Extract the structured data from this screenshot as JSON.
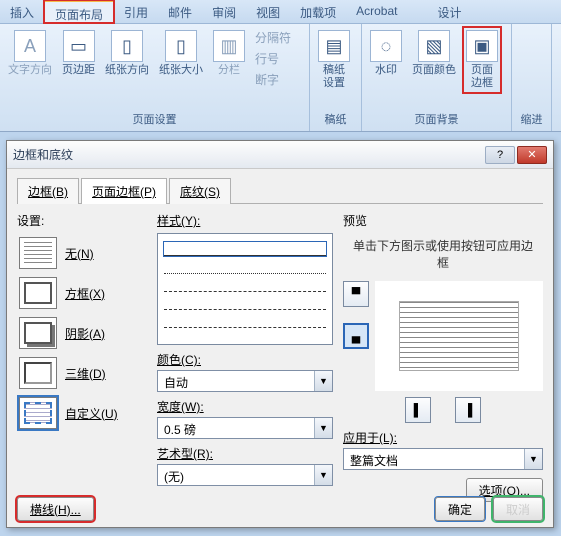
{
  "ribbon": {
    "tabs": [
      "插入",
      "页面布局",
      "引用",
      "邮件",
      "审阅",
      "视图",
      "加载项",
      "Acrobat",
      "设计"
    ],
    "active_index": 1,
    "groups": {
      "page_setup": {
        "label": "页面设置",
        "items": {
          "text_direction": "文字方向",
          "margins": "页边距",
          "orientation": "纸张方向",
          "size": "纸张大小",
          "columns": "分栏"
        },
        "mini": {
          "breaks": "分隔符",
          "line_numbers": "行号",
          "hyphenation": "断字"
        }
      },
      "paper": {
        "label": "稿纸",
        "item": "稿纸\n设置"
      },
      "background": {
        "label": "页面背景",
        "items": {
          "watermark": "水印",
          "page_color": "页面颜色",
          "page_border": "页面\n边框"
        }
      },
      "indent_label": "缩进"
    }
  },
  "dialog": {
    "title": "边框和底纹",
    "tabs": {
      "border": "边框(B)",
      "page_border": "页面边框(P)",
      "shading": "底纹(S)"
    },
    "active_tab": "page_border",
    "setting": {
      "label": "设置:",
      "options": {
        "none": "无(N)",
        "box": "方框(X)",
        "shadow": "阴影(A)",
        "threeD": "三维(D)",
        "custom": "自定义(U)"
      },
      "selected": "custom"
    },
    "style": {
      "label": "样式(Y):"
    },
    "color": {
      "label": "颜色(C):",
      "value": "自动"
    },
    "width": {
      "label": "宽度(W):",
      "value": "0.5 磅"
    },
    "art": {
      "label": "艺术型(R):",
      "value": "(无)"
    },
    "preview": {
      "label": "预览",
      "hint": "单击下方图示或使用按钮可应用边框"
    },
    "apply": {
      "label": "应用于(L):",
      "value": "整篇文档"
    },
    "options_btn": "选项(O)...",
    "footer": {
      "hline": "横线(H)...",
      "ok": "确定",
      "cancel": "取消"
    }
  }
}
